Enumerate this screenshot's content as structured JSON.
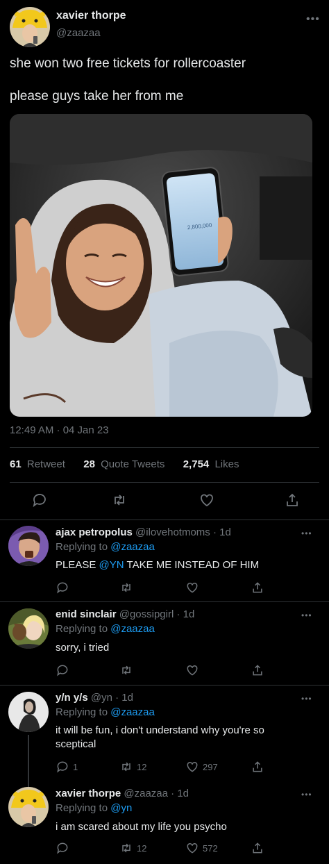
{
  "main": {
    "name": "xavier thorpe",
    "handle": "@zaazaa",
    "text_line1": "she won two free tickets for rollercoaster",
    "text_line2": "please guys take her from me",
    "timestamp": "12:49 AM · 04 Jan 23",
    "stats": {
      "retweets_count": "61",
      "retweets_label": "Retweet",
      "quotes_count": "28",
      "quotes_label": "Quote Tweets",
      "likes_count": "2,754",
      "likes_label": "Likes"
    },
    "photo_screen_text": "2,800,000"
  },
  "replies": [
    {
      "name": "ajax petropolus",
      "handle": "@ilovehotmoms",
      "time": "· 1d",
      "replying_prefix": "Replying to",
      "replying_to": "@zaazaa",
      "body_pre": "PLEASE ",
      "body_mention": "@YN",
      "body_post": " TAKE ME INSTEAD OF HIM",
      "reply_count": "",
      "retweet_count": "",
      "like_count": ""
    },
    {
      "name": "enid sinclair",
      "handle": "@gossipgirl",
      "time": "· 1d",
      "replying_prefix": "Replying to",
      "replying_to": "@zaazaa",
      "body": "sorry, i tried",
      "reply_count": "",
      "retweet_count": "",
      "like_count": ""
    },
    {
      "name": "y/n y/s",
      "handle": "@yn",
      "time": "· 1d",
      "replying_prefix": "Replying to",
      "replying_to": "@zaazaa",
      "body": "it will be fun, i don't understand why you're so sceptical",
      "reply_count": "1",
      "retweet_count": "12",
      "like_count": "297"
    },
    {
      "name": "xavier thorpe",
      "handle": "@zaazaa",
      "time": "· 1d",
      "replying_prefix": "Replying to",
      "replying_to": "@yn",
      "body": "i am scared about my life you psycho",
      "reply_count": "",
      "retweet_count": "12",
      "like_count": "572"
    }
  ],
  "colors": {
    "link": "#1d9bf0",
    "muted": "#71767b",
    "divider": "#2f3336",
    "background": "#000000"
  }
}
